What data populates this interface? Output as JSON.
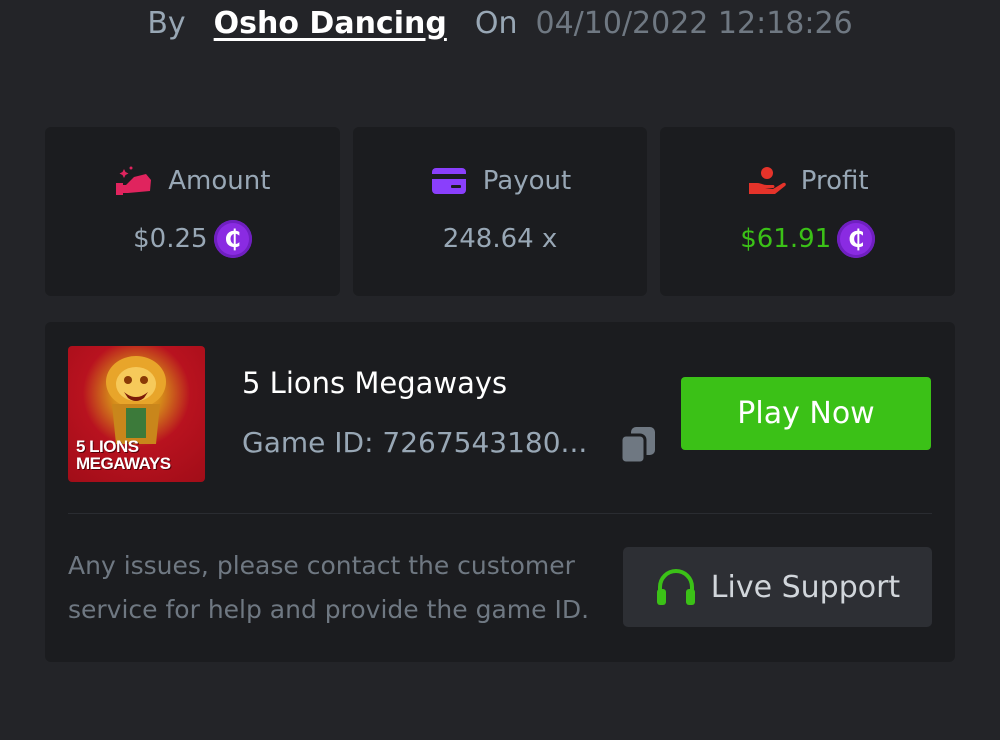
{
  "byline": {
    "by_label": "By",
    "username": "Osho Dancing",
    "on_label": "On",
    "datetime": "04/10/2022 12:18:26"
  },
  "stats": {
    "amount": {
      "label": "Amount",
      "value": "$0.25",
      "icon": "amount-hand-icon",
      "color": "#e0245e"
    },
    "payout": {
      "label": "Payout",
      "value": "248.64 x",
      "icon": "card-icon",
      "color": "#8a3ffc"
    },
    "profit": {
      "label": "Profit",
      "value": "$61.91",
      "icon": "profit-hand-icon",
      "color": "#e5332a"
    },
    "coin_symbol": "₵",
    "coin_color": "#8a2be2",
    "profit_color": "#3bc117"
  },
  "game": {
    "title": "5 Lions Megaways",
    "thumb_text_line1": "5 LIONS",
    "thumb_text_line2": "MEGAWAYS",
    "id_label": "Game ID: 7267543180...",
    "play_label": "Play Now",
    "play_color": "#3bc117"
  },
  "support": {
    "help_text": "Any issues, please contact the customer service for help and provide the game ID.",
    "button_label": "Live Support",
    "icon": "headset-icon"
  }
}
